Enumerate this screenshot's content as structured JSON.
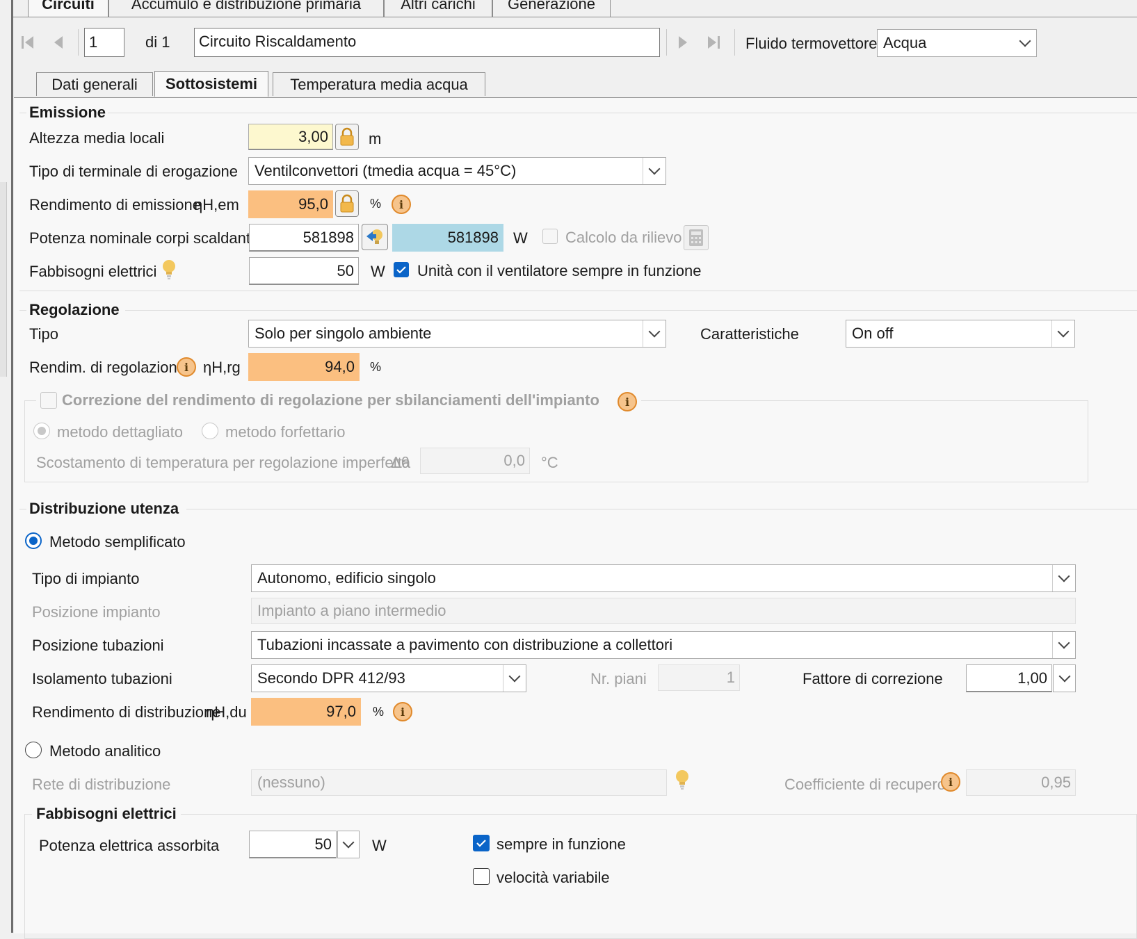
{
  "top_tabs": [
    "Circuiti",
    "Accumulo e distribuzione primaria",
    "Altri carichi",
    "Generazione"
  ],
  "nav": {
    "record_number": "1",
    "of_label": "di 1",
    "circuit_name": "Circuito Riscaldamento",
    "fluid_label": "Fluido termovettore",
    "fluid_value": "Acqua"
  },
  "sub_tabs": [
    "Dati generali",
    "Sottosistemi",
    "Temperatura media acqua"
  ],
  "emissione": {
    "title": "Emissione",
    "altezza_label": "Altezza media locali",
    "altezza_value": "3,00",
    "altezza_unit": "m",
    "terminale_label": "Tipo di terminale di erogazione",
    "terminale_value": "Ventilconvettori (tmedia acqua = 45°C)",
    "rendimento_label": "Rendimento di emissione",
    "rendimento_symbol": "ηH,em",
    "rendimento_value": "95,0",
    "rendimento_unit": "%",
    "potenza_label": "Potenza nominale corpi scaldanti",
    "potenza_value": "581898",
    "potenza_calc_value": "581898",
    "potenza_unit": "W",
    "rilievo_label": "Calcolo da rilievo",
    "fabbisogni_label": "Fabbisogni elettrici",
    "fabbisogni_value": "50",
    "fabbisogni_unit": "W",
    "ventilatore_label": "Unità con il ventilatore sempre in funzione"
  },
  "regolazione": {
    "title": "Regolazione",
    "tipo_label": "Tipo",
    "tipo_value": "Solo per singolo ambiente",
    "caratteristiche_label": "Caratteristiche",
    "caratteristiche_value": "On off",
    "rendimento_label": "Rendim. di regolazione",
    "rendimento_symbol": "ηH,rg",
    "rendimento_value": "94,0",
    "rendimento_unit": "%",
    "correzione_label": "Correzione del rendimento di regolazione per sbilanciamenti dell'impianto",
    "metodo_dettagliato": "metodo dettagliato",
    "metodo_forfettario": "metodo forfettario",
    "scostamento_label": "Scostamento di temperatura per regolazione imperfetta",
    "scostamento_symbol": "Δθ",
    "scostamento_value": "0,0",
    "scostamento_unit": "°C"
  },
  "distribuzione": {
    "title": "Distribuzione utenza",
    "metodo_semplificato": "Metodo semplificato",
    "tipo_impianto_label": "Tipo di impianto",
    "tipo_impianto_value": "Autonomo, edificio singolo",
    "posizione_impianto_label": "Posizione impianto",
    "posizione_impianto_value": "Impianto a piano intermedio",
    "posizione_tubazioni_label": "Posizione tubazioni",
    "posizione_tubazioni_value": "Tubazioni incassate a pavimento con distribuzione a collettori",
    "isolamento_label": "Isolamento tubazioni",
    "isolamento_value": "Secondo DPR 412/93",
    "nr_piani_label": "Nr. piani",
    "nr_piani_value": "1",
    "fattore_label": "Fattore di correzione",
    "fattore_value": "1,00",
    "rendimento_label": "Rendimento di distribuzione",
    "rendimento_symbol": "ηH,du",
    "rendimento_value": "97,0",
    "rendimento_unit": "%",
    "metodo_analitico": "Metodo analitico",
    "rete_label": "Rete di distribuzione",
    "rete_value": "(nessuno)",
    "coeff_label": "Coefficiente di recupero",
    "coeff_value": "0,95"
  },
  "fabbisogni_elettrici": {
    "title": "Fabbisogni elettrici",
    "potenza_label": "Potenza elettrica assorbita",
    "potenza_value": "50",
    "potenza_unit": "W",
    "sempre_label": "sempre in funzione",
    "velocita_label": "velocità variabile"
  },
  "colors": {
    "computed_orange": "#fbbf80",
    "input_yellow": "#fdf8cf",
    "calc_blue": "#add8e6",
    "accent_blue": "#0a64c8"
  }
}
